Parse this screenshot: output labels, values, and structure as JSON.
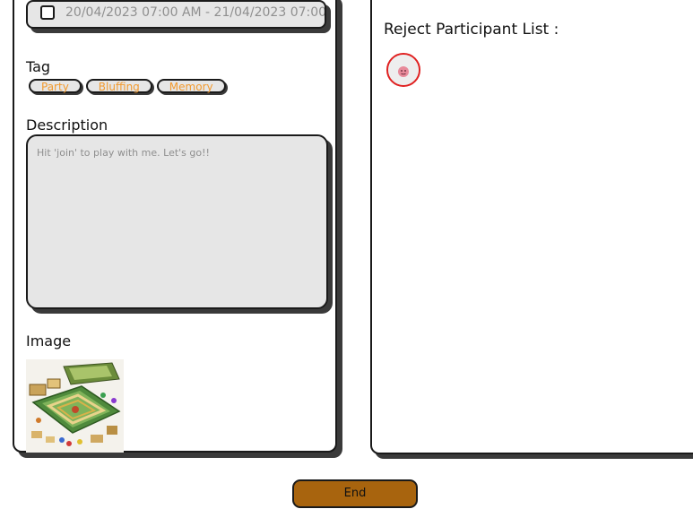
{
  "event": {
    "date_range": "20/04/2023 07:00 AM - 21/04/2023 07:00"
  },
  "tag_section": {
    "label": "Tag",
    "tags": [
      "Party",
      "Bluffing",
      "Memory"
    ]
  },
  "description_section": {
    "label": "Description",
    "text": "Hit 'join' to play with me. Let's go!!"
  },
  "image_section": {
    "label": "Image"
  },
  "reject_section": {
    "title": "Reject Participant List :",
    "avatar_border_color": "#e02020"
  },
  "actions": {
    "end_label": "End"
  },
  "colors": {
    "tag_text": "#f29a2e",
    "end_button": "#a8640e"
  }
}
